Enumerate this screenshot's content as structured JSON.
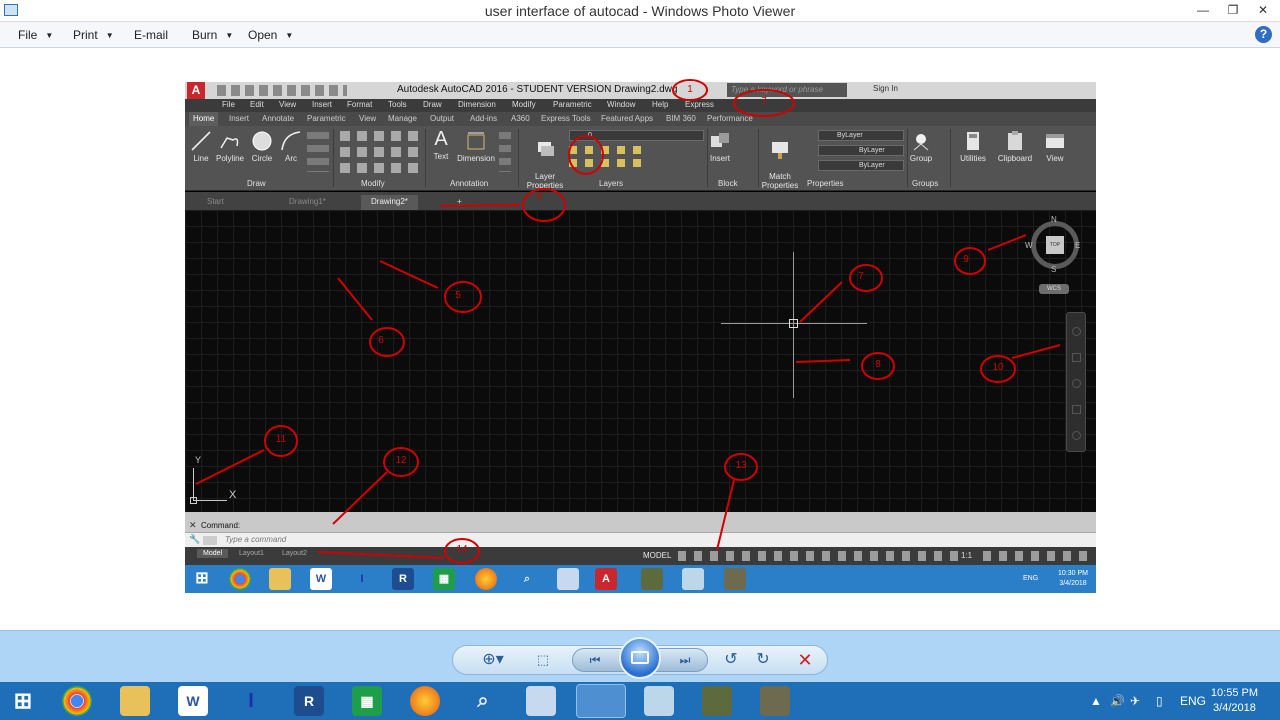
{
  "window": {
    "title": "user interface of autocad - Windows Photo Viewer",
    "minimize": "—",
    "maximize": "❐",
    "close": "✕"
  },
  "menu": [
    {
      "label": "File",
      "has_arrow": true
    },
    {
      "label": "Print",
      "has_arrow": true
    },
    {
      "label": "E-mail",
      "has_arrow": false
    },
    {
      "label": "Burn",
      "has_arrow": true
    },
    {
      "label": "Open",
      "has_arrow": true
    }
  ],
  "help_label": "?",
  "autocad": {
    "logo": "A",
    "title": "Autodesk AutoCAD 2016 - STUDENT VERSION    Drawing2.dwg",
    "search_placeholder": "Type a keyword or phrase",
    "signin": "Sign In",
    "menubar": [
      "File",
      "Edit",
      "View",
      "Insert",
      "Format",
      "Tools",
      "Draw",
      "Dimension",
      "Modify",
      "Parametric",
      "Window",
      "Help",
      "Express"
    ],
    "ribbon_tabs": [
      "Home",
      "Insert",
      "Annotate",
      "Parametric",
      "View",
      "Manage",
      "Output",
      "Add-ins",
      "A360",
      "Express Tools",
      "Featured Apps",
      "BIM 360",
      "Performance"
    ],
    "draw_tools": [
      "Line",
      "Polyline",
      "Circle",
      "Arc"
    ],
    "annotation_tools": [
      "Text",
      "Dimension"
    ],
    "layer_tool": "Layer\nProperties",
    "layer_value": "0",
    "block_tool": "Insert",
    "match_tool": "Match\nProperties",
    "prop_values": [
      "ByLayer",
      "ByLayer",
      "ByLayer"
    ],
    "group_tool": "Group",
    "right_tools": [
      "Utilities",
      "Clipboard",
      "View"
    ],
    "panels": [
      "Draw",
      "Modify",
      "Annotation",
      "Layers",
      "Block",
      "Properties",
      "Groups"
    ],
    "file_tabs": [
      "Start",
      "Drawing1*",
      "Drawing2*"
    ],
    "plus_tab": "+",
    "viewcube": {
      "n": "N",
      "s": "S",
      "e": "E",
      "w": "W",
      "top": "TOP",
      "wcs": "WCS"
    },
    "ucs": {
      "x": "X",
      "y": "Y"
    },
    "command_label": "Command:",
    "command_placeholder": "Type a command",
    "layout_tabs": [
      "Model",
      "Layout1",
      "Layout2"
    ],
    "model_status": "MODEL",
    "scale": "1:1",
    "inner_lang": "ENG",
    "inner_time": "10:30 PM",
    "inner_date": "3/4/2018"
  },
  "annotations": [
    "1",
    "7",
    "4",
    "5",
    "6",
    "7",
    "8",
    "9",
    "10",
    "11",
    "12",
    "13",
    "14"
  ],
  "taskbar": {
    "lang": "ENG",
    "time": "10:55 PM",
    "date": "3/4/2018"
  },
  "colors": {
    "accent_red": "#d10000",
    "acad_red": "#c8282d",
    "taskbar_blue": "#1e6fb8",
    "viewer_toolbar": "#aed5f5"
  }
}
